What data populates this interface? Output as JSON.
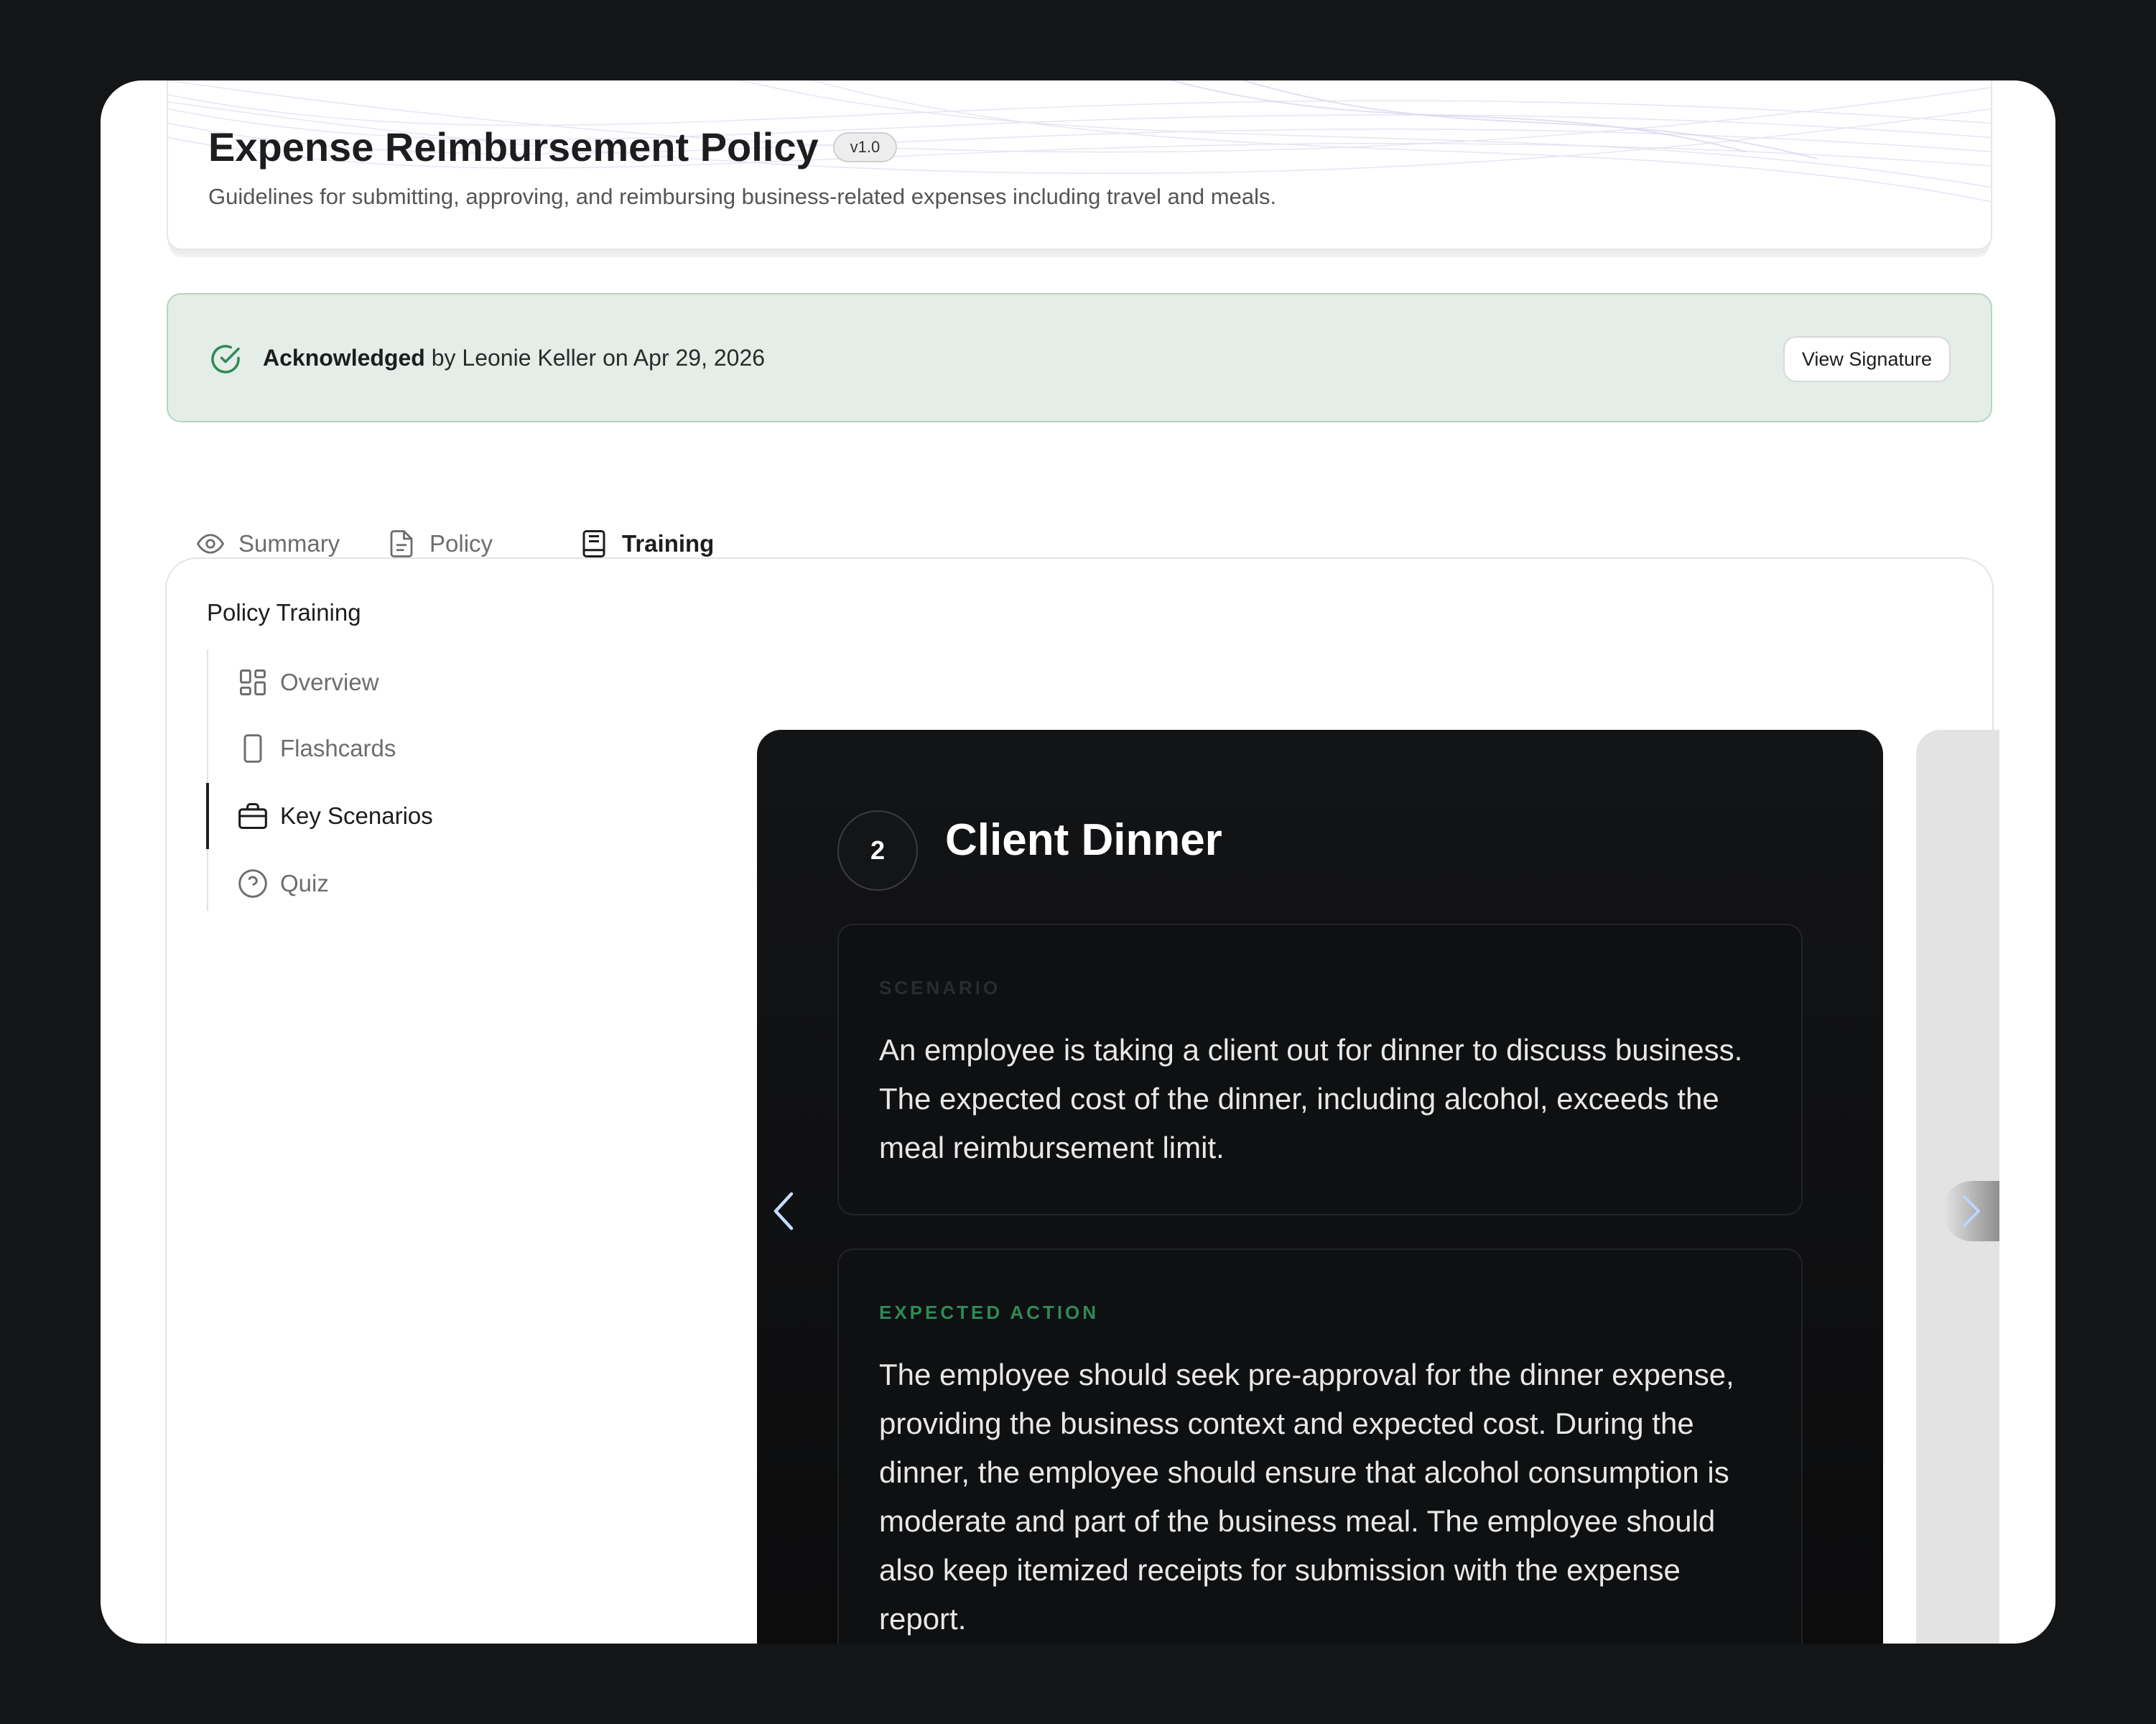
{
  "header": {
    "title": "Expense Reimbursement Policy",
    "version": "v1.0",
    "description": "Guidelines for submitting, approving, and reimbursing business-related expenses including travel and meals."
  },
  "acknowledgement": {
    "status": "Acknowledged",
    "detail": "by Leonie Keller on Apr 29, 2026",
    "button_label": "View Signature",
    "icon": "check-circle-icon",
    "accent_color": "#2f8a57"
  },
  "tabs": [
    {
      "label": "Summary",
      "icon": "eye-icon"
    },
    {
      "label": "Policy",
      "icon": "document-icon"
    },
    {
      "label": "Training",
      "icon": "book-icon",
      "active": true
    }
  ],
  "training": {
    "title": "Policy Training",
    "nav": [
      {
        "label": "Overview",
        "icon": "grid-icon"
      },
      {
        "label": "Flashcards",
        "icon": "card-icon"
      },
      {
        "label": "Key Scenarios",
        "icon": "briefcase-icon",
        "active": true
      },
      {
        "label": "Quiz",
        "icon": "question-circle-icon"
      }
    ]
  },
  "scenario": {
    "number": "2",
    "title": "Client Dinner",
    "scenario_label": "SCENARIO",
    "scenario_text": "An employee is taking a client out for dinner to discuss business. The expected cost of the dinner, including alcohol, exceeds the meal reimbursement limit.",
    "action_label": "EXPECTED ACTION",
    "action_text": "The employee should seek pre-approval for the dinner expense, providing the business context and expected cost. During the dinner, the employee should ensure that alcohol consumption is moderate and part of the business meal. The employee should also keep itemized receipts for submission with the expense report."
  }
}
